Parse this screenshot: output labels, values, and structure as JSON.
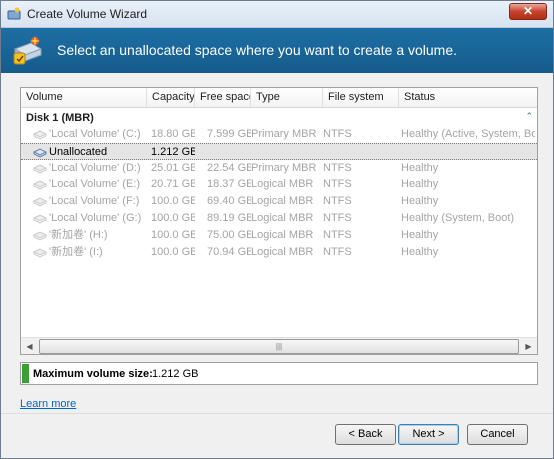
{
  "window": {
    "title": "Create Volume Wizard",
    "close_glyph": "✕"
  },
  "banner": {
    "text": "Select an unallocated space where you want to create a volume.",
    "icon": "disk-wizard-icon"
  },
  "columns": [
    "Volume",
    "Capacity",
    "Free space",
    "Type",
    "File system",
    "Status"
  ],
  "disk_group": {
    "label": "Disk 1 (MBR)",
    "collapse_glyph": "⌃"
  },
  "rows": [
    {
      "volume": "'Local Volume' (C:)",
      "capacity": "18.80 GB",
      "free": "7.599 GB",
      "type": "Primary MBR",
      "fs": "NTFS",
      "status": "Healthy (Active, System, Boot)",
      "selected": false
    },
    {
      "volume": "Unallocated",
      "capacity": "1.212 GB",
      "free": "",
      "type": "",
      "fs": "",
      "status": "",
      "selected": true
    },
    {
      "volume": "'Local Volume' (D:)",
      "capacity": "25.01 GB",
      "free": "22.54 GB",
      "type": "Primary MBR",
      "fs": "NTFS",
      "status": "Healthy",
      "selected": false
    },
    {
      "volume": "'Local Volume' (E:)",
      "capacity": "20.71 GB",
      "free": "18.37 GB",
      "type": "Logical MBR",
      "fs": "NTFS",
      "status": "Healthy",
      "selected": false
    },
    {
      "volume": "'Local Volume' (F:)",
      "capacity": "100.0 GB",
      "free": "69.40 GB",
      "type": "Logical MBR",
      "fs": "NTFS",
      "status": "Healthy",
      "selected": false
    },
    {
      "volume": "'Local Volume' (G:)",
      "capacity": "100.0 GB",
      "free": "89.19 GB",
      "type": "Logical MBR",
      "fs": "NTFS",
      "status": "Healthy (System, Boot)",
      "selected": false
    },
    {
      "volume": "'新加卷' (H:)",
      "capacity": "100.0 GB",
      "free": "75.00 GB",
      "type": "Logical MBR",
      "fs": "NTFS",
      "status": "Healthy",
      "selected": false
    },
    {
      "volume": "'新加卷' (I:)",
      "capacity": "100.0 GB",
      "free": "70.94 GB",
      "type": "Logical MBR",
      "fs": "NTFS",
      "status": "Healthy",
      "selected": false
    }
  ],
  "scrollbar": {
    "left_glyph": "◀",
    "right_glyph": "▶",
    "thumb_glyph": "|||"
  },
  "max_size": {
    "label": "Maximum volume size:",
    "value": "1.212 GB"
  },
  "learn_more": "Learn more",
  "buttons": {
    "back": "< Back",
    "next": "Next >",
    "cancel": "Cancel"
  }
}
